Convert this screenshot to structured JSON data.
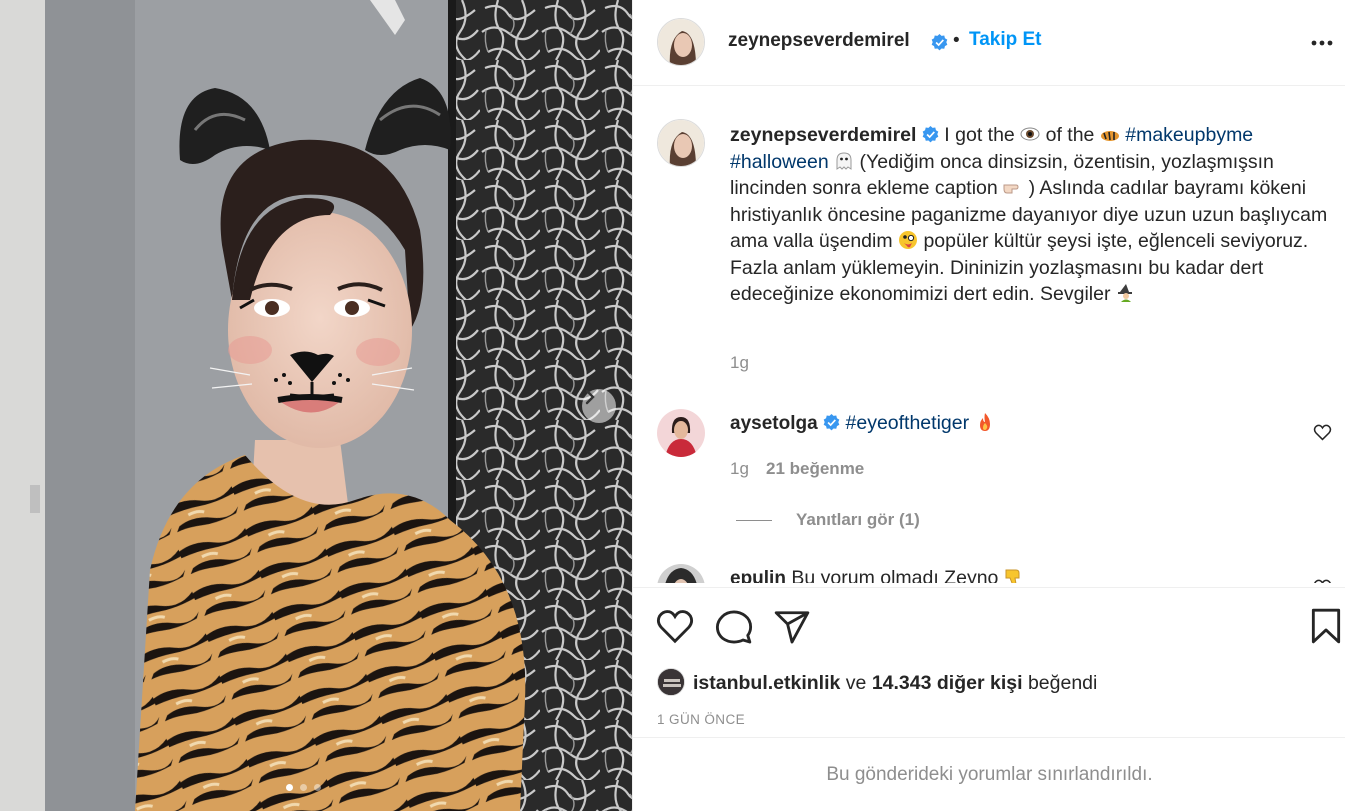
{
  "header": {
    "username": "zeynepseverdemirel",
    "separator": "•",
    "follow_label": "Takip Et",
    "more_icon": "more-horizontal-icon"
  },
  "caption": {
    "username": "zeynepseverdemirel",
    "text_1": "I got the",
    "text_2": "of the",
    "tag_1": "#makeupbyme",
    "tag_2": "#halloween",
    "text_3": "(Yediğim onca dinsizsin, özentisin, yozlaşmışsın lincinden sonra ekleme caption",
    "text_4": ") Aslında cadılar bayramı kökeni hristiyanlık öncesine paganizme dayanıyor diye uzun uzun başlıycam ama valla üşendim",
    "text_5": "popüler kültür şeysi işte, eğlenceli seviyoruz. Fazla anlam yüklemeyin. Dininizin yozlaşmasını bu kadar dert edeceğinize ekonomimizi dert edin. Sevgiler",
    "age": "1g"
  },
  "comments": [
    {
      "username": "aysetolga",
      "text": "#eyeofthetiger",
      "age": "1g",
      "likes": "21 beğenme"
    },
    {
      "username": "epulin",
      "text": "Bu yorum olmadı Zeyno"
    }
  ],
  "replies_label": "Yanıtları gör (1)",
  "likes": {
    "user": "istanbul.etkinlik",
    "connector": "ve",
    "others": "14.343 diğer kişi",
    "suffix": "beğendi"
  },
  "timestamp": "1 GÜN ÖNCE",
  "restricted_notice": "Bu gönderideki yorumlar sınırlandırıldı.",
  "carousel": {
    "total_slides": 3,
    "current_slide": 1
  },
  "colors": {
    "link_blue": "#0095f6",
    "hashtag": "#00376b",
    "muted": "#8e8e8e",
    "verified": "#3897f0"
  }
}
